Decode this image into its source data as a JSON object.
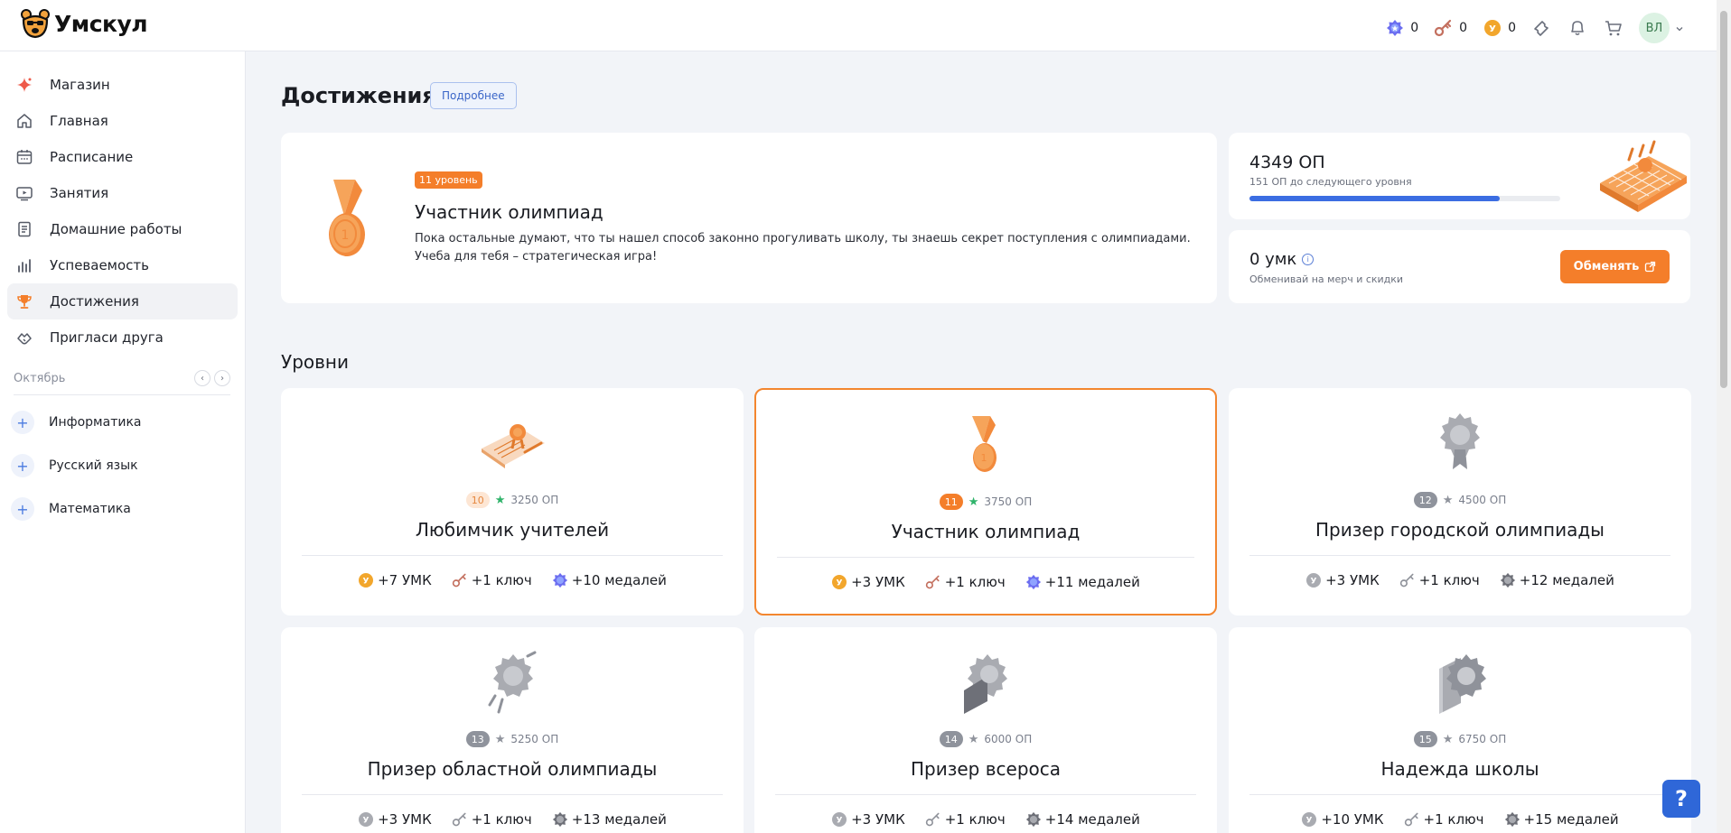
{
  "header": {
    "logo_text": "Умскул",
    "stats": [
      {
        "icon": "medal-icon",
        "value": "0"
      },
      {
        "icon": "key-icon",
        "value": "0"
      },
      {
        "icon": "umk-coin-icon",
        "value": "0"
      }
    ],
    "avatar": "ВЛ"
  },
  "sidebar": {
    "items": [
      {
        "label": "Магазин",
        "icon": "sparkle-icon"
      },
      {
        "label": "Главная",
        "icon": "home-icon"
      },
      {
        "label": "Расписание",
        "icon": "calendar-icon"
      },
      {
        "label": "Занятия",
        "icon": "video-icon"
      },
      {
        "label": "Домашние работы",
        "icon": "homework-icon"
      },
      {
        "label": "Успеваемость",
        "icon": "stats-icon"
      },
      {
        "label": "Достижения",
        "icon": "trophy-icon",
        "active": true
      },
      {
        "label": "Пригласи друга",
        "icon": "handshake-icon"
      }
    ],
    "month": "Октябрь",
    "subjects": [
      "Информатика",
      "Русский язык",
      "Математика"
    ]
  },
  "main": {
    "title": "Достижения",
    "more_button": "Подробнее",
    "hero": {
      "level_badge": "11 уровень",
      "title": "Участник олимпиад",
      "description": "Пока остальные думают, что ты нашел способ законно прогуливать школу, ты знаешь секрет поступления с олимпиадами. Учеба для тебя – стратегическая игра!"
    },
    "op": {
      "value": "4349 ОП",
      "sub": "151 ОП до следующего уровня",
      "progress": 0.805
    },
    "umk": {
      "value": "0 умк",
      "sub": "Обменивай на мерч и скидки",
      "button": "Обменять"
    },
    "levels_title": "Уровни",
    "levels": [
      {
        "num": "10",
        "op": "3250 ОП",
        "name": "Любимчик учителей",
        "state": "past",
        "rewards": [
          "+7 УМК",
          "+1 ключ",
          "+10 медалей"
        ]
      },
      {
        "num": "11",
        "op": "3750 ОП",
        "name": "Участник олимпиад",
        "state": "current",
        "rewards": [
          "+3 УМК",
          "+1 ключ",
          "+11 медалей"
        ]
      },
      {
        "num": "12",
        "op": "4500 ОП",
        "name": "Призер городской олимпиады",
        "state": "future",
        "rewards": [
          "+3 УМК",
          "+1 ключ",
          "+12 медалей"
        ]
      },
      {
        "num": "13",
        "op": "5250 ОП",
        "name": "Призер областной олимпиады",
        "state": "future",
        "rewards": [
          "+3 УМК",
          "+1 ключ",
          "+13 медалей"
        ]
      },
      {
        "num": "14",
        "op": "6000 ОП",
        "name": "Призер всероса",
        "state": "future",
        "rewards": [
          "+3 УМК",
          "+1 ключ",
          "+14 медалей"
        ]
      },
      {
        "num": "15",
        "op": "6750 ОП",
        "name": "Надежда школы",
        "state": "future",
        "rewards": [
          "+10 УМК",
          "+1 ключ",
          "+15 медалей"
        ]
      }
    ]
  },
  "help_button": "?",
  "colors": {
    "accent": "#f47e2a",
    "blue": "#3b6de2",
    "bg": "#f2f4f8"
  }
}
